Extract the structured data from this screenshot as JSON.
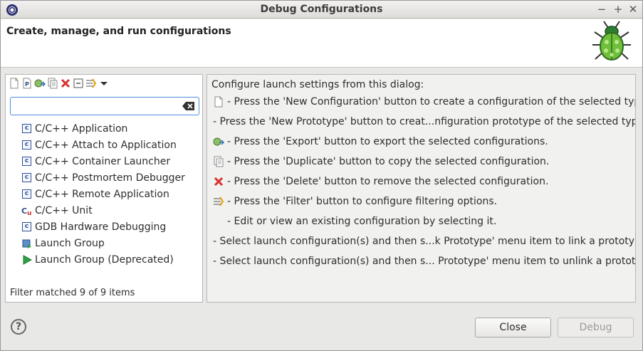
{
  "window": {
    "title": "Debug Configurations",
    "controls": {
      "minimize": "−",
      "maximize": "+",
      "close": "✕"
    }
  },
  "header": {
    "title": "Create, manage, and run configurations",
    "icon": "bug-icon"
  },
  "left": {
    "toolbar": [
      "new-configuration-icon",
      "new-prototype-icon",
      "export-icon",
      "duplicate-icon",
      "delete-icon",
      "collapse-all-icon",
      "filter-icon",
      "view-menu-icon"
    ],
    "search": {
      "value": "",
      "placeholder": ""
    },
    "tree": [
      {
        "label": "C/C++ Application",
        "icon": "c-app-icon"
      },
      {
        "label": "C/C++ Attach to Application",
        "icon": "c-app-icon"
      },
      {
        "label": "C/C++ Container Launcher",
        "icon": "c-app-icon"
      },
      {
        "label": "C/C++ Postmortem Debugger",
        "icon": "c-app-icon"
      },
      {
        "label": "C/C++ Remote Application",
        "icon": "c-app-icon"
      },
      {
        "label": "C/C++ Unit",
        "icon": "c-unit-icon"
      },
      {
        "label": "GDB Hardware Debugging",
        "icon": "c-app-icon"
      },
      {
        "label": "Launch Group",
        "icon": "launch-group-icon"
      },
      {
        "label": "Launch Group (Deprecated)",
        "icon": "run-icon"
      }
    ],
    "filter_status": "Filter matched 9 of 9 items"
  },
  "right": {
    "intro": "Configure launch settings from this dialog:",
    "lines": [
      {
        "text": "- Press the 'New Configuration' button to create a configuration of the selected type.",
        "icon": "new-configuration-icon"
      },
      {
        "text": "- Press the 'New Prototype' button to creat...nfiguration prototype of the selected type.",
        "icon": ""
      },
      {
        "text": "- Press the 'Export' button to export the selected configurations.",
        "icon": "export-icon"
      },
      {
        "text": "- Press the 'Duplicate' button to copy the selected configuration.",
        "icon": "duplicate-icon"
      },
      {
        "text": "- Press the 'Delete' button to remove the selected configuration.",
        "icon": "delete-icon"
      },
      {
        "text": "- Press the 'Filter' button to configure filtering options.",
        "icon": "filter-icon"
      },
      {
        "text": "- Edit or view an existing configuration by selecting it.",
        "icon": ""
      },
      {
        "text": "- Select launch configuration(s) and then s...k Prototype' menu item to link a prototype.",
        "icon": ""
      },
      {
        "text": "- Select launch configuration(s) and then s... Prototype' menu item to unlink a prototype.",
        "icon": ""
      }
    ]
  },
  "footer": {
    "help": "?",
    "close_label": "Close",
    "debug_label": "Debug"
  },
  "colors": {
    "accent": "#4a90d9",
    "delete": "#d9322b",
    "run": "#2fa044"
  }
}
